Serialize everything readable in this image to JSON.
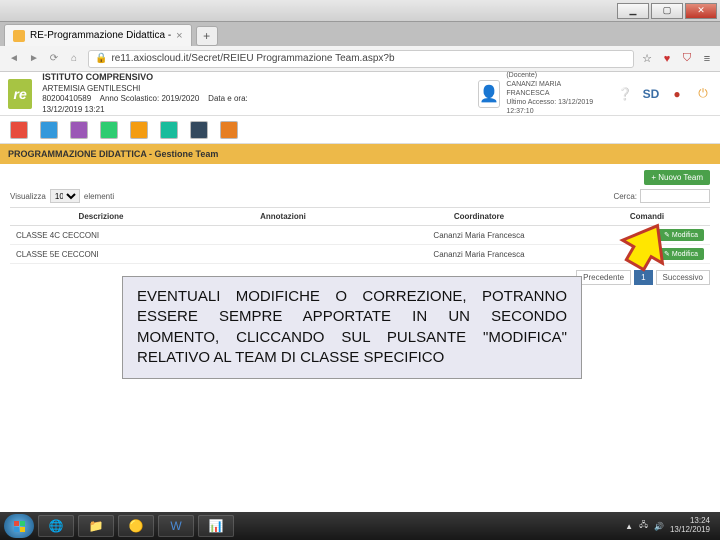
{
  "window": {
    "tab_title": "RE-Programmazione Didattica -",
    "url": "re11.axioscloud.it/Secret/REIEU Programmazione Team.aspx?b"
  },
  "header": {
    "logo": "re",
    "school_line1": "ISTITUTO COMPRENSIVO",
    "school_line2": "ARTEMISIA GENTILESCHI",
    "school_code": "80200410589",
    "school_year_label": "Anno Scolastico: 2019/2020",
    "school_datetime": "Data e ora: 13/12/2019 13:21",
    "user_role": "(Docente)",
    "user_name": "CANANZI MARIA FRANCESCA",
    "last_access": "Ultimo Accesso: 13/12/2019 12:37:10",
    "sd": "SD"
  },
  "breadcrumb": "PROGRAMMAZIONE DIDATTICA - Gestione Team",
  "controls": {
    "new_team": "+ Nuovo Team",
    "show_label": "Visualizza",
    "show_value": "10",
    "show_suffix": "elementi",
    "search_label": "Cerca:",
    "search_value": ""
  },
  "table": {
    "headers": {
      "desc": "Descrizione",
      "ann": "Annotazioni",
      "coord": "Coordinatore",
      "cmd": "Comandi"
    },
    "rows": [
      {
        "desc": "CLASSE 4C CECCONI",
        "ann": "",
        "coord": "Cananzi Maria Francesca",
        "cmd": "Modifica"
      },
      {
        "desc": "CLASSE 5E CECCONI",
        "ann": "",
        "coord": "Cananzi Maria Francesca",
        "cmd": "Modifica"
      }
    ]
  },
  "pagination": {
    "prev": "Precedente",
    "page": "1",
    "next": "Successivo"
  },
  "annotation": "EVENTUALI MODIFICHE O CORREZIONE, POTRANNO ESSERE SEMPRE APPORTATE IN UN SECONDO MOMENTO, CLICCANDO SUL PULSANTE \"MODIFICA\" RELATIVO AL TEAM DI CLASSE SPECIFICO",
  "taskbar": {
    "time": "13:24",
    "date": "13/12/2019"
  }
}
